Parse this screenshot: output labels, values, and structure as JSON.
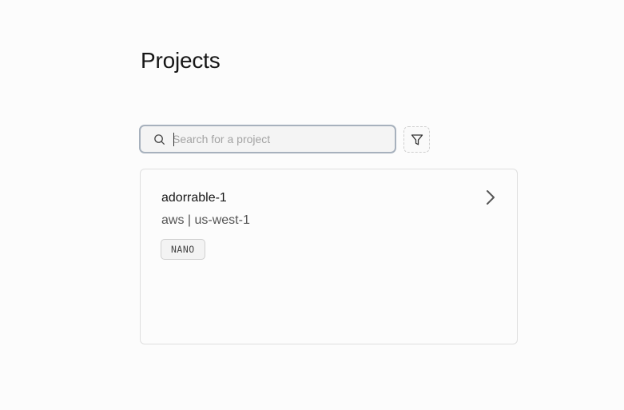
{
  "page": {
    "title": "Projects"
  },
  "search": {
    "placeholder": "Search for a project",
    "value": "",
    "icon": "search-icon"
  },
  "filter": {
    "icon": "filter-icon"
  },
  "projects": [
    {
      "name": "adorrable-1",
      "provider": "aws",
      "region": "us-west-1",
      "meta": "aws | us-west-1",
      "tier": "NANO",
      "icon": "chevron-right-icon"
    }
  ]
}
